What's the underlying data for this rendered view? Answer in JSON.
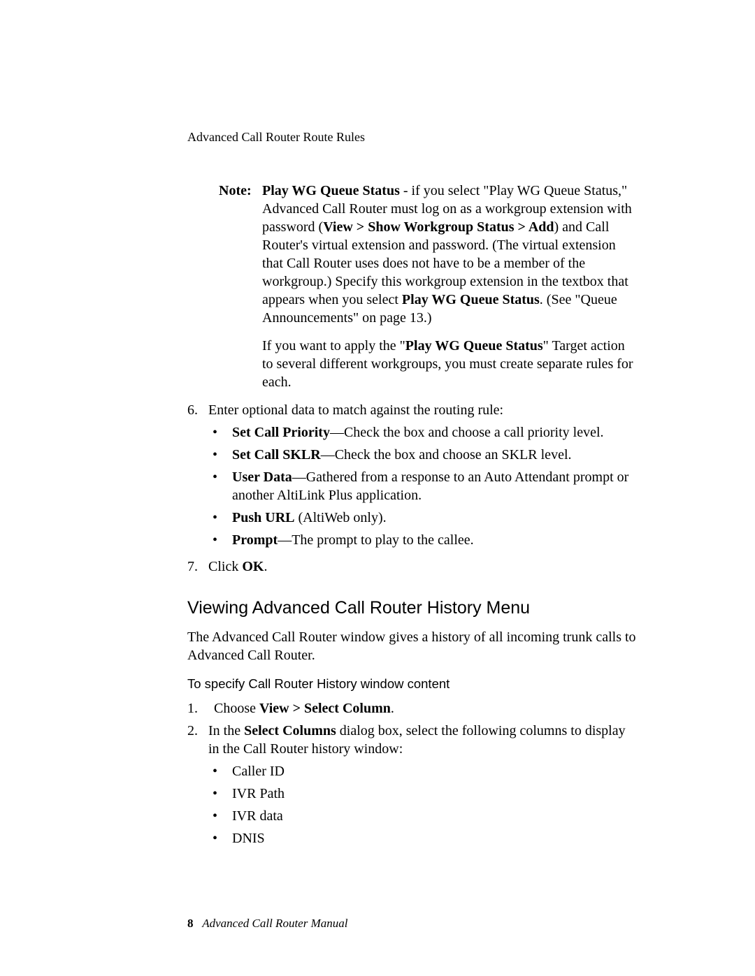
{
  "runningHead": "Advanced Call Router Route Rules",
  "note": {
    "label": "Note:",
    "body_parts": {
      "b1": "Play WG Queue Status",
      "t1": " - if you select \"Play WG Queue Status,\" Advanced Call Router must log on as a workgroup extension with password (",
      "b2": "View > Show Workgroup Status > Add",
      "t2": ") and Call Router's virtual extension and password. (The virtual extension that Call Router uses does not have to be a member of the workgroup.) Specify this workgroup extension in the textbox that appears when you select ",
      "b3": "Play WG Queue Status",
      "t3": ". (See \"Queue Announcements\" on page 13.)"
    },
    "extra_parts": {
      "t1": "If you want to apply the \"",
      "b1": "Play WG Queue Status",
      "t2": "\" Target action to several different workgroups, you must create separate rules for each."
    }
  },
  "stepsA": {
    "s6": {
      "num": "6.",
      "text": "Enter optional data to match against the routing rule:",
      "bullets": [
        {
          "b": "Set Call Priority",
          "t": "—Check the box and choose a call priority level."
        },
        {
          "b": "Set Call SKLR",
          "t": "—Check the box and choose an SKLR level."
        },
        {
          "b": "User Data",
          "t": "—Gathered from a response to an Auto Attendant prompt or another AltiLink Plus application."
        },
        {
          "b": "Push URL",
          "t": " (AltiWeb only)."
        },
        {
          "b": "Prompt",
          "t": "—The prompt to play to the callee."
        }
      ]
    },
    "s7": {
      "num": "7.",
      "t1": "Click ",
      "b1": "OK",
      "t2": "."
    }
  },
  "sectionTitle": "Viewing Advanced Call Router History Menu",
  "sectionPara": "The Advanced Call Router window gives a history of all incoming trunk calls to Advanced Call Router.",
  "subhead": "To specify Call Router History window content",
  "stepsB": {
    "s1": {
      "num": "1.",
      "t1": "Choose ",
      "b1": "View > Select Column",
      "t2": "."
    },
    "s2": {
      "num": "2.",
      "t1": "In the ",
      "b1": "Select Columns",
      "t2": " dialog box, select the following columns to display in the Call Router history window:",
      "bullets": [
        "Caller ID",
        "IVR Path",
        "IVR data",
        "DNIS"
      ]
    }
  },
  "footer": {
    "page": "8",
    "title": "Advanced Call Router Manual"
  }
}
